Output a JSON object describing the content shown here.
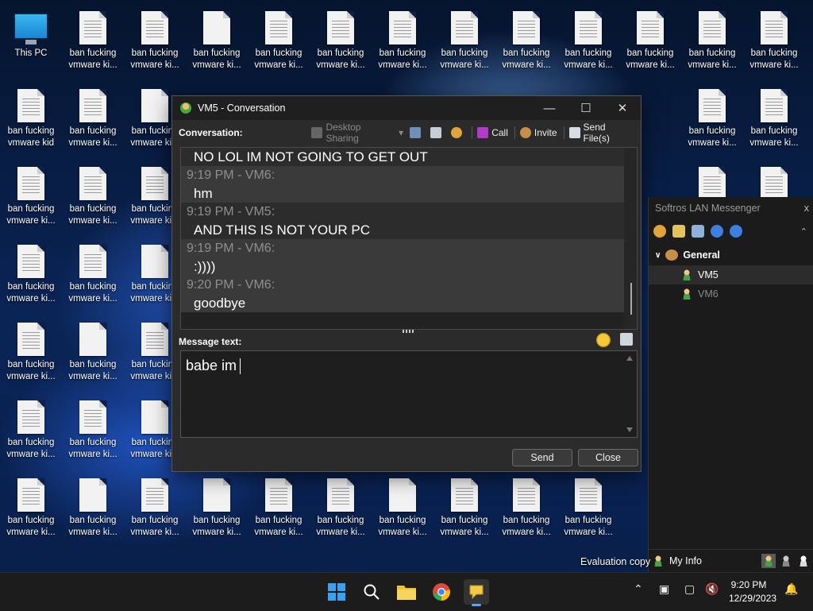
{
  "desktop": {
    "this_pc": "This PC",
    "icons": [
      [
        "ban fucking",
        "vmware ki..."
      ],
      [
        "ban fucking",
        "vmware kid"
      ],
      [
        "ban fucking",
        "vmware ki..."
      ]
    ]
  },
  "conversation": {
    "title": "VM5 - Conversation",
    "toolbar": {
      "conversation_label": "Conversation:",
      "desktop_sharing": "Desktop Sharing",
      "call": "Call",
      "invite": "Invite",
      "send_files": "Send File(s)"
    },
    "messages": [
      {
        "text": "NO LOL IM NOT GOING TO GET OUT"
      },
      {
        "header": "9:19 PM - VM6:",
        "text": "hm"
      },
      {
        "header": "9:19 PM - VM5:",
        "text": "AND THIS IS NOT YOUR PC"
      },
      {
        "header": "9:19 PM - VM6:",
        "text": ":))))"
      },
      {
        "header": "9:20 PM - VM6:",
        "text": "goodbye"
      }
    ],
    "message_label": "Message text:",
    "input_value": "babe im",
    "send_label": "Send",
    "close_label": "Close"
  },
  "messenger": {
    "title": "Softros LAN Messenger",
    "close": "x",
    "group": "General",
    "users": [
      "VM5",
      "VM6"
    ],
    "my_info": "My Info"
  },
  "watermark": "Evaluation copy",
  "taskbar": {
    "time": "9:20 PM",
    "date": "12/29/2023"
  },
  "colors": {
    "accent": "#5aa0ff",
    "online": "#45a346"
  }
}
